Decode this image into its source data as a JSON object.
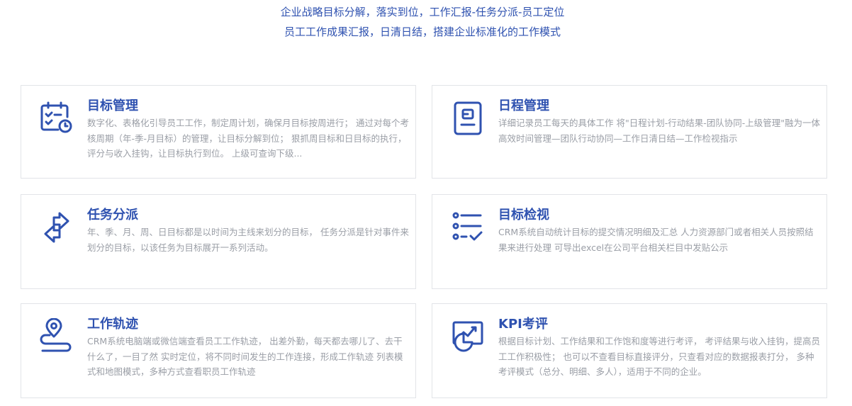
{
  "header": {
    "line1": "企业战略目标分解，落实到位，工作汇报-任务分派-员工定位",
    "line2": "员工工作成果汇报，日清日结，搭建企业标准化的工作模式"
  },
  "colors": {
    "accent": "#2f52b0",
    "text_muted": "#9a9ea6",
    "border": "#e2e4e8"
  },
  "cards": [
    {
      "icon": "calendar-check-clock-icon",
      "title": "目标管理",
      "desc": "数字化、表格化引导员工工作，制定周计划，确保月目标按周进行； 通过对每个考核周期（年-季-月目标）的管理，让目标分解到位； 狠抓周目标和日目标的执行，评分与收入挂钩，让目标执行到位。 上级可查询下级..."
    },
    {
      "icon": "document-icon",
      "title": "日程管理",
      "desc": "详细记录员工每天的具体工作 将\"日程计划-行动结果-团队协同-上级管理\"融为一体 高效时间管理—团队行动协同—工作日清日结—工作检视指示"
    },
    {
      "icon": "swap-arrows-icon",
      "title": "任务分派",
      "desc": "年、季、月、周、日目标都是以时间为主线来划分的目标， 任务分派是针对事件来划分的目标，以该任务为目标展开一系列活动。"
    },
    {
      "icon": "checklist-icon",
      "title": "目标检视",
      "desc": "CRM系统自动统计目标的提交情况明细及汇总 人力资源部门或者相关人员按照结果来进行处理 可导出excel在公司平台相关栏目中发贴公示"
    },
    {
      "icon": "location-track-icon",
      "title": "工作轨迹",
      "desc": "CRM系统电脑端或微信端查看员工工作轨迹， 出差外勤，每天都去哪儿了、去干什么了，一目了然 实时定位，将不同时间发生的工作连接，形成工作轨迹 列表模式和地图模式，多种方式查看职员工作轨迹"
    },
    {
      "icon": "chart-pie-icon",
      "title": "KPI考评",
      "desc": "根据目标计划、工作结果和工作饱和度等进行考评， 考评结果与收入挂钩，提高员工工作积极性； 也可以不查看目标直接评分，只查看对应的数据报表打分， 多种考评模式（总分、明细、多人），适用于不同的企业。"
    }
  ]
}
